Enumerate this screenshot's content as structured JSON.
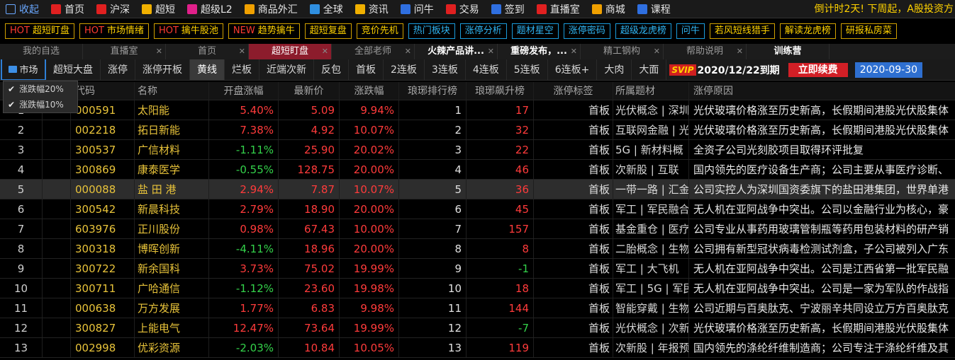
{
  "menubar": {
    "items": [
      {
        "label": "收起",
        "icon": "collapse-icon",
        "color": "#6aa8ff"
      },
      {
        "label": "首页",
        "icon": "home-icon",
        "color": "#e02020"
      },
      {
        "label": "沪深",
        "icon": "trend-icon",
        "color": "#e02020"
      },
      {
        "label": "超短",
        "icon": "bookmark-icon",
        "color": "#f0b000"
      },
      {
        "label": "超级L2",
        "icon": "l2-icon",
        "color": "#e0208a"
      },
      {
        "label": "商品外汇",
        "icon": "coin-icon",
        "color": "#f0a000"
      },
      {
        "label": "全球",
        "icon": "globe-icon",
        "color": "#2f8fe0"
      },
      {
        "label": "资讯",
        "icon": "news-icon",
        "color": "#f0b000"
      },
      {
        "label": "问牛",
        "icon": "search-icon",
        "color": "#2f6fe0"
      },
      {
        "label": "交易",
        "icon": "trade-icon",
        "color": "#e02020"
      },
      {
        "label": "签到",
        "icon": "calendar-icon",
        "color": "#2f6fe0"
      },
      {
        "label": "直播室",
        "icon": "play-icon",
        "color": "#e02020"
      },
      {
        "label": "商城",
        "icon": "shop-icon",
        "color": "#f0a000"
      },
      {
        "label": "课程",
        "icon": "course-icon",
        "color": "#2f6fe0"
      }
    ],
    "countdown": "倒计时2天! 下周起，A股投资方"
  },
  "quickbar": [
    {
      "hot": "HOT",
      "label": "超短盯盘",
      "style": "yellow"
    },
    {
      "hot": "HOT",
      "label": "市场情绪",
      "style": "yellow"
    },
    {
      "hot": "HOT",
      "label": "擒牛股池",
      "style": "yellow"
    },
    {
      "hot": "NEW",
      "label": "趋势擒牛",
      "style": "yellow"
    },
    {
      "hot": "",
      "label": "超短复盘",
      "style": "yellow"
    },
    {
      "hot": "",
      "label": "竞价先机",
      "style": "yellow"
    },
    {
      "hot": "",
      "label": "热门板块",
      "style": "blue"
    },
    {
      "hot": "",
      "label": "涨停分析",
      "style": "blue"
    },
    {
      "hot": "",
      "label": "题材星空",
      "style": "blue"
    },
    {
      "hot": "",
      "label": "涨停密码",
      "style": "blue"
    },
    {
      "hot": "",
      "label": "超级龙虎榜",
      "style": "blue"
    },
    {
      "hot": "",
      "label": "问牛",
      "style": "blue"
    },
    {
      "hot": "",
      "label": "若风短线猎手",
      "style": "yellow"
    },
    {
      "hot": "",
      "label": "解读龙虎榜",
      "style": "yellow"
    },
    {
      "hot": "",
      "label": "研报私房菜",
      "style": "yellow"
    }
  ],
  "tabs": [
    {
      "label": "我的自选",
      "closable": false,
      "state": ""
    },
    {
      "label": "直播室",
      "closable": true,
      "state": ""
    },
    {
      "label": "首页",
      "closable": true,
      "state": ""
    },
    {
      "label": "超短盯盘",
      "closable": true,
      "state": "active"
    },
    {
      "label": "全部老师",
      "closable": true,
      "state": ""
    },
    {
      "label": "火辣产品讲...",
      "closable": true,
      "state": "bold"
    },
    {
      "label": "重磅发布，...",
      "closable": true,
      "state": "bold"
    },
    {
      "label": "精工钢构",
      "closable": true,
      "state": ""
    },
    {
      "label": "帮助说明",
      "closable": true,
      "state": ""
    },
    {
      "label": "训练营",
      "closable": false,
      "state": "bold"
    }
  ],
  "subbar": {
    "market_label": "市场",
    "buttons": [
      {
        "label": "超短大盘",
        "active": false
      },
      {
        "label": "涨停",
        "active": false
      },
      {
        "label": "涨停开板",
        "active": false
      },
      {
        "label": "黄线",
        "active": true
      },
      {
        "label": "烂板",
        "active": false
      },
      {
        "label": "近端次新",
        "active": false
      },
      {
        "label": "反包",
        "active": false
      },
      {
        "label": "首板",
        "active": false
      },
      {
        "label": "2连板",
        "active": false
      },
      {
        "label": "3连板",
        "active": false
      },
      {
        "label": "4连板",
        "active": false
      },
      {
        "label": "5连板",
        "active": false
      },
      {
        "label": "6连板+",
        "active": false
      },
      {
        "label": "大肉",
        "active": false
      },
      {
        "label": "大面",
        "active": false
      }
    ],
    "svip_badge": "SVIP",
    "svip_expiry": "2020/12/22到期",
    "renew_label": "立即续费",
    "date": "2020-09-30"
  },
  "dropdown": {
    "items": [
      {
        "label": "涨跌幅20%",
        "checked": true
      },
      {
        "label": "涨跌幅10%",
        "checked": true
      }
    ]
  },
  "table": {
    "headers": {
      "idx": "",
      "chk": "",
      "code": "代码",
      "name": "名称",
      "open": "开盘涨幅",
      "last": "最新价",
      "pct": "涨跌幅",
      "rank": "琅琊排行榜",
      "rise": "琅琊飙升榜",
      "tag": "涨停标签",
      "theme": "所属题材",
      "reason": "涨停原因"
    },
    "rows": [
      {
        "idx": "1",
        "code": "000591",
        "name": "太阳能",
        "open": "5.40%",
        "open_dir": "up",
        "last": "5.09",
        "pct": "9.94%",
        "rank": "1",
        "rise": "17",
        "rise_dir": "up",
        "tag": "首板",
        "theme": "光伏概念 | 深圳",
        "reason": "光伏玻璃价格涨至历史新高，长假期间港股光伏股集体"
      },
      {
        "idx": "2",
        "code": "002218",
        "name": "拓日新能",
        "open": "7.38%",
        "open_dir": "up",
        "last": "4.92",
        "pct": "10.07%",
        "rank": "2",
        "rise": "32",
        "rise_dir": "up",
        "tag": "首板",
        "theme": "互联网金融 | 光",
        "reason": "光伏玻璃价格涨至历史新高，长假期间港股光伏股集体"
      },
      {
        "idx": "3",
        "code": "300537",
        "name": "广信材料",
        "open": "-1.11%",
        "open_dir": "down",
        "last": "25.90",
        "pct": "20.02%",
        "rank": "3",
        "rise": "22",
        "rise_dir": "up",
        "tag": "首板",
        "theme": "5G | 新材料概",
        "reason": "全资子公司光刻胶项目取得环评批复"
      },
      {
        "idx": "4",
        "code": "300869",
        "name": "康泰医学",
        "open": "-0.55%",
        "open_dir": "down",
        "last": "128.75",
        "pct": "20.00%",
        "rank": "4",
        "rise": "46",
        "rise_dir": "up",
        "tag": "首板",
        "theme": "次新股 | 互联",
        "reason": "国内领先的医疗设备生产商；公司主要从事医疗诊断、"
      },
      {
        "idx": "5",
        "code": "000088",
        "name": "盐 田 港",
        "open": "2.94%",
        "open_dir": "up",
        "last": "7.87",
        "pct": "10.07%",
        "rank": "5",
        "rise": "36",
        "rise_dir": "up",
        "tag": "首板",
        "theme": "一带一路 | 汇金",
        "reason": "公司实控人为深圳国资委旗下的盐田港集团，世界单港"
      },
      {
        "idx": "6",
        "code": "300542",
        "name": "新晨科技",
        "open": "2.79%",
        "open_dir": "up",
        "last": "18.90",
        "pct": "20.00%",
        "rank": "6",
        "rise": "45",
        "rise_dir": "up",
        "tag": "首板",
        "theme": "军工 | 军民融合",
        "reason": "无人机在亚阿战争中突出。公司以金融行业为核心，豪"
      },
      {
        "idx": "7",
        "code": "603976",
        "name": "正川股份",
        "open": "0.98%",
        "open_dir": "up",
        "last": "67.43",
        "pct": "10.00%",
        "rank": "7",
        "rise": "157",
        "rise_dir": "up",
        "tag": "首板",
        "theme": "基金重仓 | 医疗",
        "reason": "公司专业从事药用玻璃管制瓶等药用包装材料的研产销"
      },
      {
        "idx": "8",
        "code": "300318",
        "name": "博晖创新",
        "open": "-4.11%",
        "open_dir": "down",
        "last": "18.96",
        "pct": "20.00%",
        "rank": "8",
        "rise": "8",
        "rise_dir": "up",
        "tag": "首板",
        "theme": "二胎概念 | 生物",
        "reason": "公司拥有新型冠状病毒检测试剂盒，子公司被列入广东"
      },
      {
        "idx": "9",
        "code": "300722",
        "name": "新余国科",
        "open": "3.73%",
        "open_dir": "up",
        "last": "75.02",
        "pct": "19.99%",
        "rank": "9",
        "rise": "-1",
        "rise_dir": "down",
        "tag": "首板",
        "theme": "军工 | 大飞机",
        "reason": "无人机在亚阿战争中突出。公司是江西省第一批军民融"
      },
      {
        "idx": "10",
        "code": "300711",
        "name": "广哈通信",
        "open": "-1.12%",
        "open_dir": "down",
        "last": "23.60",
        "pct": "19.98%",
        "rank": "10",
        "rise": "18",
        "rise_dir": "up",
        "tag": "首板",
        "theme": "军工 | 5G | 军民",
        "reason": "无人机在亚阿战争中突出。公司是一家为军队的作战指"
      },
      {
        "idx": "11",
        "code": "000638",
        "name": "万方发展",
        "open": "1.77%",
        "open_dir": "up",
        "last": "6.83",
        "pct": "9.98%",
        "rank": "11",
        "rise": "144",
        "rise_dir": "up",
        "tag": "首板",
        "theme": "智能穿戴 | 生物",
        "reason": "公司近期与百奥肽克、宁波丽辛共同设立万方百奥肽克"
      },
      {
        "idx": "12",
        "code": "300827",
        "name": "上能电气",
        "open": "12.47%",
        "open_dir": "up",
        "last": "73.64",
        "pct": "19.99%",
        "rank": "12",
        "rise": "-7",
        "rise_dir": "down",
        "tag": "首板",
        "theme": "光伏概念 | 次新",
        "reason": "光伏玻璃价格涨至历史新高，长假期间港股光伏股集体"
      },
      {
        "idx": "13",
        "code": "002998",
        "name": "优彩资源",
        "open": "-2.03%",
        "open_dir": "down",
        "last": "10.84",
        "pct": "10.05%",
        "rank": "13",
        "rise": "119",
        "rise_dir": "up",
        "tag": "首板",
        "theme": "次新股 | 年报预",
        "reason": "国内领先的涤纶纤维制造商；公司专注于涤纶纤维及其"
      }
    ],
    "selected_row": 4
  }
}
